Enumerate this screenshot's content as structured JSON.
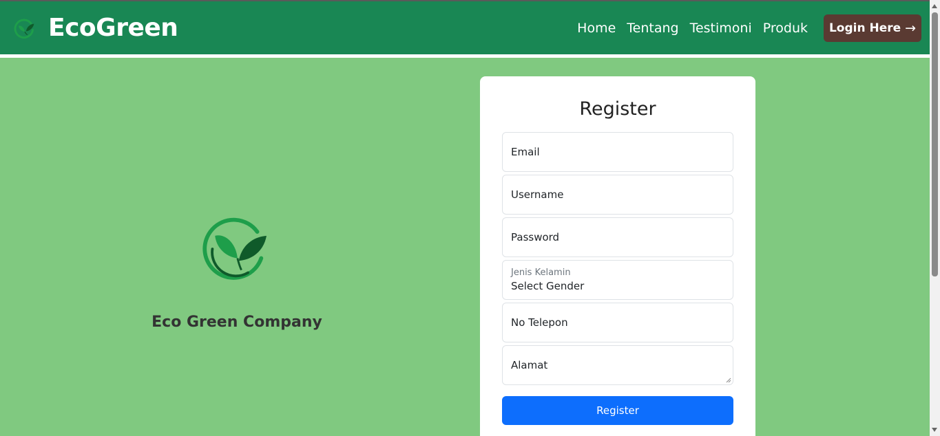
{
  "brand": {
    "name": "EcoGreen",
    "logo_icon": "leaf-circle-icon"
  },
  "nav": {
    "links": [
      "Home",
      "Tentang",
      "Testimoni",
      "Produk"
    ],
    "login_label": "Login Here",
    "login_icon": "arrow-right-icon"
  },
  "hero": {
    "company_name": "Eco Green Company",
    "logo_icon": "leaf-circle-icon"
  },
  "form": {
    "title": "Register",
    "email_placeholder": "Email",
    "username_placeholder": "Username",
    "password_placeholder": "Password",
    "gender_label": "Jenis Kelamin",
    "gender_value": "Select Gender",
    "phone_placeholder": "No Telepon",
    "address_placeholder": "Alamat",
    "submit_label": "Register"
  },
  "colors": {
    "navbar": "#198754",
    "background": "#80c980",
    "login_button": "#5a3a32",
    "primary_button": "#0d6efd"
  }
}
